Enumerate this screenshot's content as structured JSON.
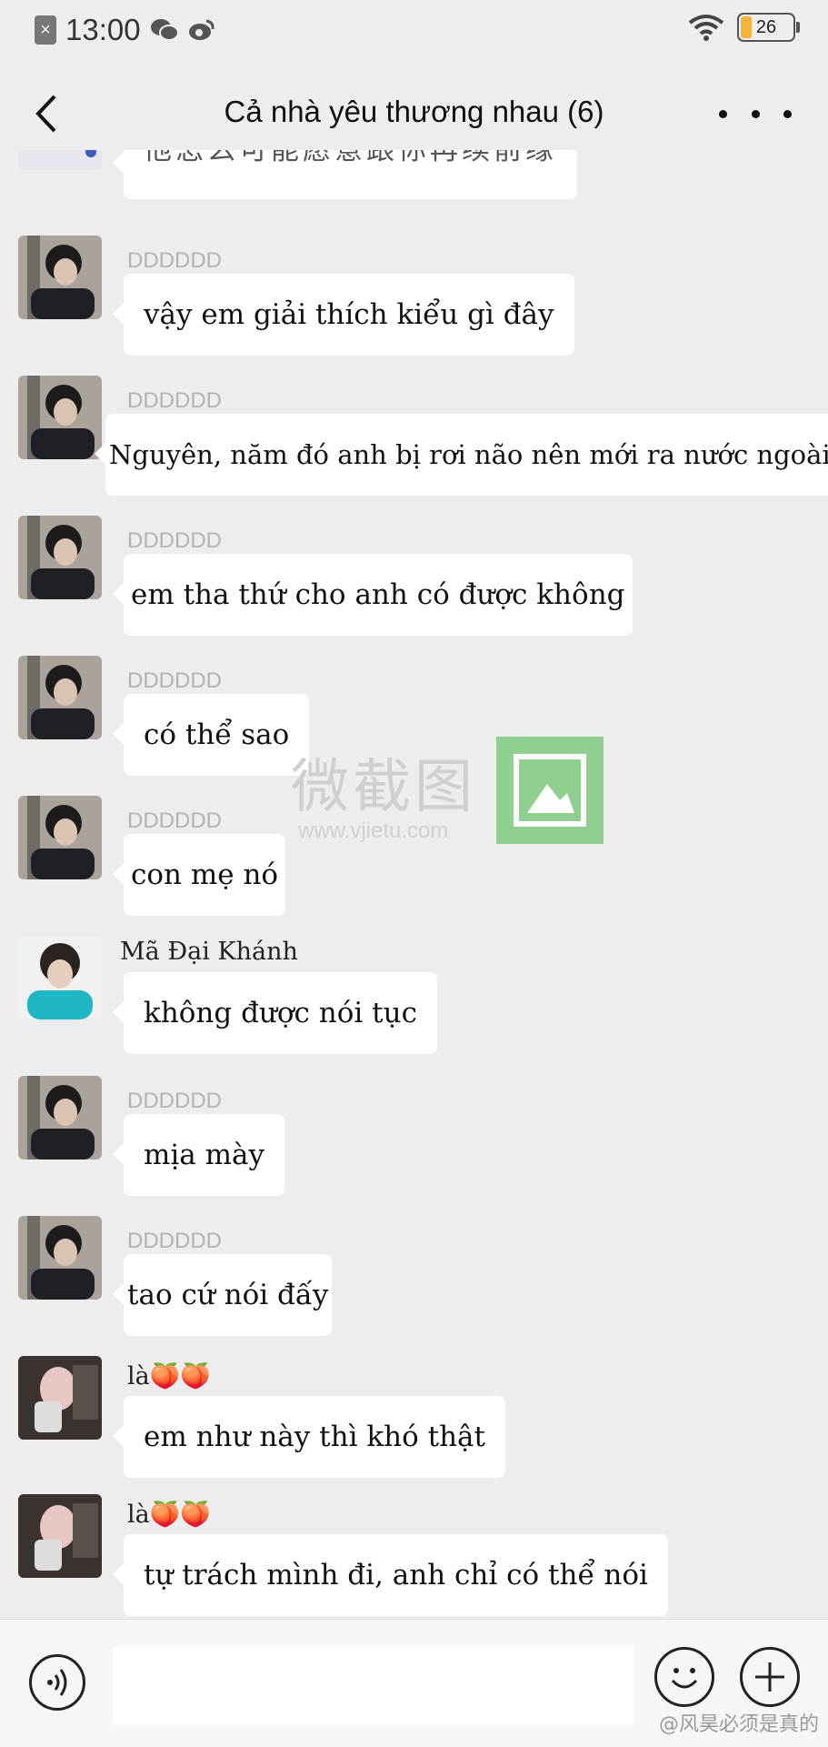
{
  "status_bar": {
    "time": "13:00",
    "battery": "26"
  },
  "header": {
    "title": "Cả nhà yêu thương nhau (6)"
  },
  "messages": [
    {
      "sender": "",
      "text": "他怎么可能愿意跟你再续前缘",
      "avatar": "avatar-boy-black-shirt"
    },
    {
      "sender": "DDDDDD",
      "text": "vậy em giải thích kiểu gì đây",
      "avatar": "avatar-boy-black-shirt"
    },
    {
      "sender": "DDDDDD",
      "text": "Nguyên, năm đó anh bị  rơi não nên mới ra nước ngoài",
      "avatar": "avatar-boy-black-shirt"
    },
    {
      "sender": "DDDDDD",
      "text": "em tha thứ cho anh có được không",
      "avatar": "avatar-boy-black-shirt"
    },
    {
      "sender": "DDDDDD",
      "text": "có thể sao",
      "avatar": "avatar-boy-black-shirt"
    },
    {
      "sender": "DDDDDD",
      "text": "con mẹ nó",
      "avatar": "avatar-boy-black-shirt"
    },
    {
      "sender": "Mã Đại Khánh",
      "text": "không được nói tục",
      "avatar": "avatar-boy-teal-hoodie"
    },
    {
      "sender": "DDDDDD",
      "text": "mịa mày",
      "avatar": "avatar-boy-black-shirt"
    },
    {
      "sender": "DDDDDD",
      "text": "tao cứ nói đấy",
      "avatar": "avatar-boy-black-shirt"
    },
    {
      "sender": "là🍑🍑",
      "text": "em như này thì khó thật",
      "avatar": "avatar-girl-mirror"
    },
    {
      "sender": "là🍑🍑",
      "text": "tự trách mình đi, anh chỉ có thể nói",
      "avatar": "avatar-girl-mirror"
    }
  ],
  "watermark": {
    "text": "微截图",
    "url": "www.vjietu.com"
  },
  "credit": "@风昊必须是真的",
  "colors": {
    "background": "#ededed",
    "bubble": "#ffffff",
    "battery": "#f2b43a",
    "watermark_box": "#8fcf8f"
  }
}
